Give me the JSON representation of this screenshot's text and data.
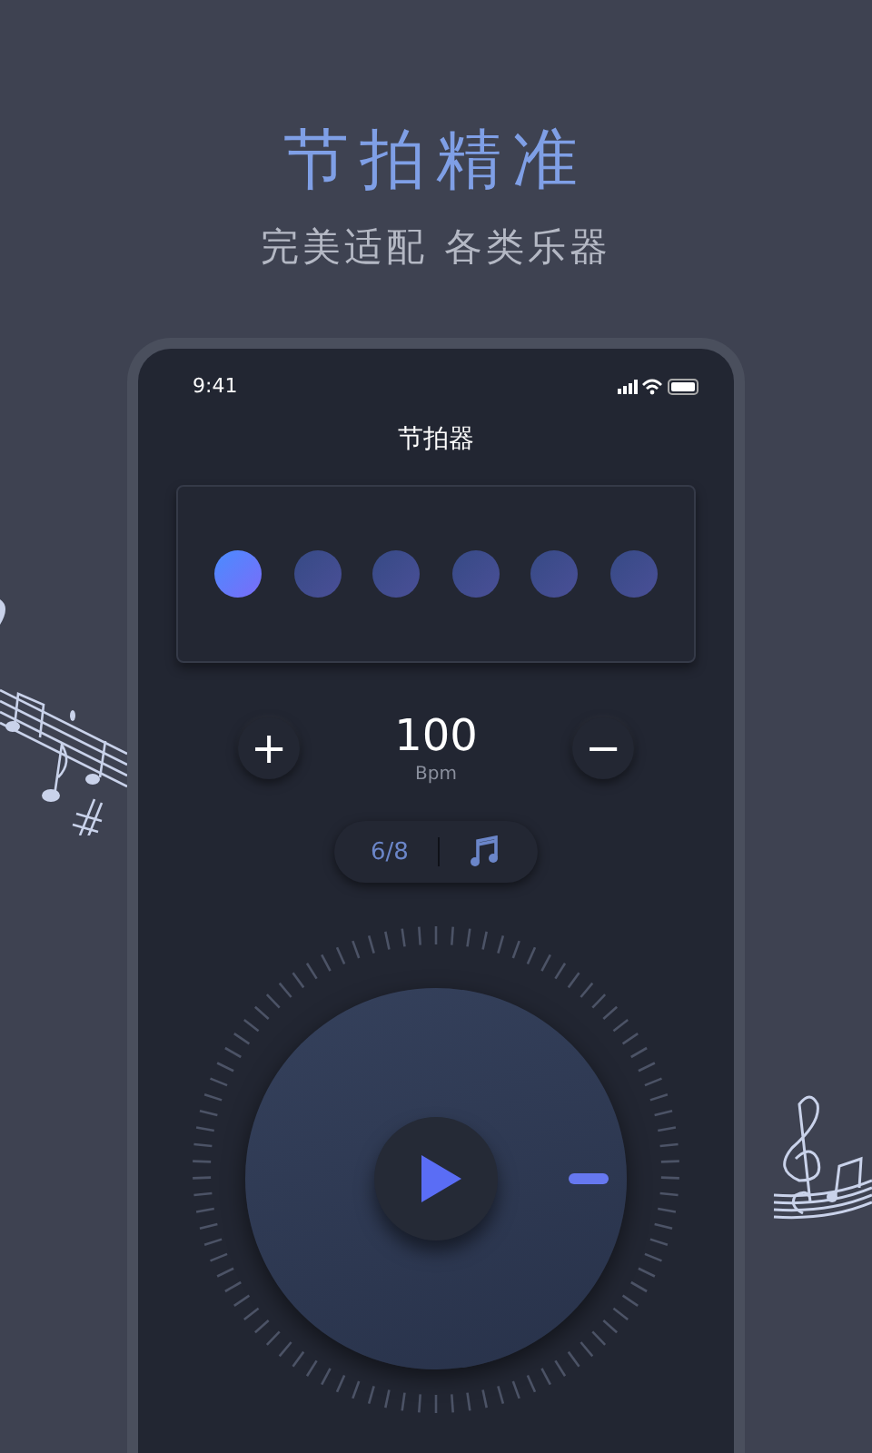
{
  "headline": "节拍精准",
  "subtitle": "完美适配 各类乐器",
  "status_bar": {
    "time": "9:41"
  },
  "screen_title": "节拍器",
  "beats": [
    {
      "selected": true
    },
    {
      "selected": false
    },
    {
      "selected": false
    },
    {
      "selected": false
    },
    {
      "selected": false
    },
    {
      "selected": false
    }
  ],
  "tempo": {
    "increase": "+",
    "value": "100",
    "unit": "Bpm",
    "decrease": "−"
  },
  "time_signature": "6/8",
  "playing": false
}
